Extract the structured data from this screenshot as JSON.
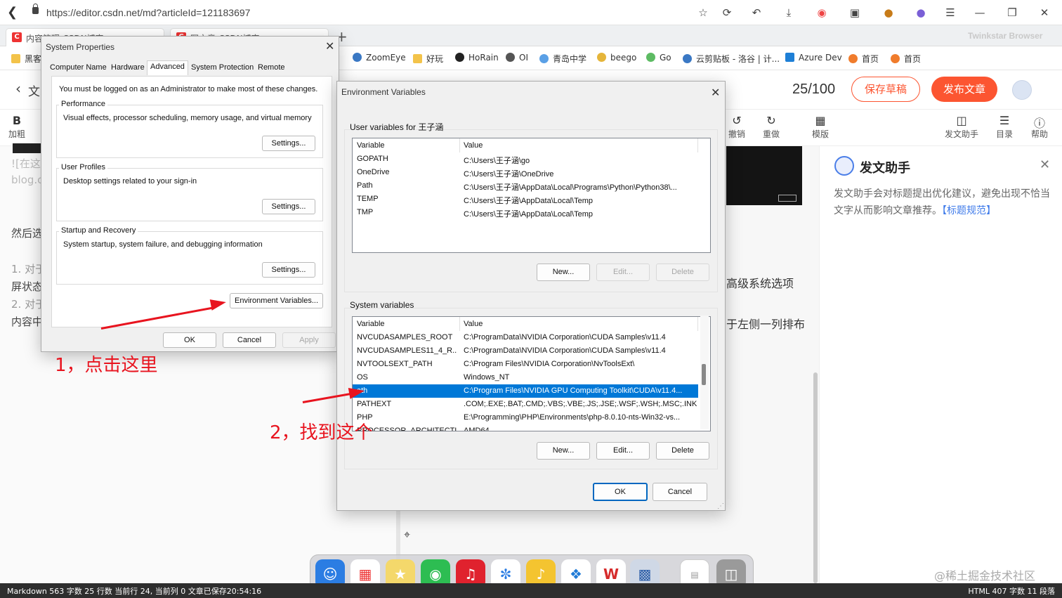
{
  "browser": {
    "url": "https://editor.csdn.net/md?articleId=121183697",
    "tabs": [
      {
        "label": "内容管理-CSDN博客"
      },
      {
        "label": "写文章-CSDN博客"
      }
    ],
    "brand": "Twinkstar Browser",
    "bookmarks": [
      "黑客",
      "ZoomEye",
      "好玩",
      "HoRain",
      "OI",
      "青岛中学",
      "beego",
      "Go",
      "云剪贴板 - 洛谷 | 计...",
      "Azure Dev",
      "首页",
      "首页"
    ]
  },
  "editor": {
    "word_count": "25/100",
    "save_draft": "保存草稿",
    "publish": "发布文章",
    "tools": {
      "bold_glyph": "B",
      "bold": "加粗",
      "undo": "撤销",
      "redo": "重做",
      "template": "模版",
      "helper": "发文助手",
      "toc": "目录",
      "help": "帮助"
    },
    "left_lines": [
      "文",
      "![在这",
      "blog.c",
      "然后选",
      "1. 对于",
      "屏状态",
      "2. 对于",
      "内容中"
    ],
    "right_lines": [
      "高级系统选项",
      "于左侧一列排布"
    ]
  },
  "helper": {
    "title": "发文助手",
    "desc": "发文助手会对标题提出优化建议，避免出现不恰当文字从而影响文章推荐。",
    "link": "【标题规范】"
  },
  "statusbar": {
    "left": "Markdown  563 字数  25 行数  当前行 24, 当前列 0  文章已保存20:54:16",
    "right": "HTML  407 字数  11 段落"
  },
  "watermark": "@稀土掘金技术社区",
  "system_properties": {
    "title": "System Properties",
    "tabs": [
      "Computer Name",
      "Hardware",
      "Advanced",
      "System Protection",
      "Remote"
    ],
    "admin_note": "You must be logged on as an Administrator to make most of these changes.",
    "performance": {
      "label": "Performance",
      "desc": "Visual effects, processor scheduling, memory usage, and virtual memory",
      "button": "Settings..."
    },
    "user_profiles": {
      "label": "User Profiles",
      "desc": "Desktop settings related to your sign-in",
      "button": "Settings..."
    },
    "startup": {
      "label": "Startup and Recovery",
      "desc": "System startup, system failure, and debugging information",
      "button": "Settings..."
    },
    "env_button": "Environment Variables...",
    "ok": "OK",
    "cancel": "Cancel",
    "apply": "Apply"
  },
  "env_vars": {
    "title": "Environment Variables",
    "user_label": "User variables for 王子涵",
    "col_variable": "Variable",
    "col_value": "Value",
    "user_vars": [
      {
        "name": "GOPATH",
        "value": "C:\\Users\\王子涵\\go"
      },
      {
        "name": "OneDrive",
        "value": "C:\\Users\\王子涵\\OneDrive"
      },
      {
        "name": "Path",
        "value": "C:\\Users\\王子涵\\AppData\\Local\\Programs\\Python\\Python38\\..."
      },
      {
        "name": "TEMP",
        "value": "C:\\Users\\王子涵\\AppData\\Local\\Temp"
      },
      {
        "name": "TMP",
        "value": "C:\\Users\\王子涵\\AppData\\Local\\Temp"
      }
    ],
    "system_label": "System variables",
    "system_vars": [
      {
        "name": "NVCUDASAMPLES_ROOT",
        "value": "C:\\ProgramData\\NVIDIA Corporation\\CUDA Samples\\v11.4"
      },
      {
        "name": "NVCUDASAMPLES11_4_R...",
        "value": "C:\\ProgramData\\NVIDIA Corporation\\CUDA Samples\\v11.4"
      },
      {
        "name": "NVTOOLSEXT_PATH",
        "value": "C:\\Program Files\\NVIDIA Corporation\\NvToolsExt\\"
      },
      {
        "name": "OS",
        "value": "Windows_NT"
      },
      {
        "name": "ath",
        "value": "C:\\Program Files\\NVIDIA GPU Computing Toolkit\\CUDA\\v11.4..."
      },
      {
        "name": "PATHEXT",
        "value": ".COM;.EXE;.BAT;.CMD;.VBS;.VBE;.JS;.JSE;.WSF;.WSH;.MSC;.INK"
      },
      {
        "name": "PHP",
        "value": "E:\\Programming\\PHP\\Environments\\php-8.0.10-nts-Win32-vs..."
      },
      {
        "name": "PROCESSOR_ARCHITECTU...",
        "value": "AMD64"
      }
    ],
    "selected_system_index": 4,
    "user_buttons": {
      "new": "New...",
      "edit": "Edit...",
      "delete": "Delete"
    },
    "system_buttons": {
      "new": "New...",
      "edit": "Edit...",
      "delete": "Delete"
    },
    "ok": "OK",
    "cancel": "Cancel"
  },
  "annotations": {
    "step1": "1，点击这里",
    "step2": "2，找到这个"
  },
  "colors": {
    "accent_red": "#fc5531",
    "selection_blue": "#0078d7",
    "annotation_red": "#e8141f"
  }
}
